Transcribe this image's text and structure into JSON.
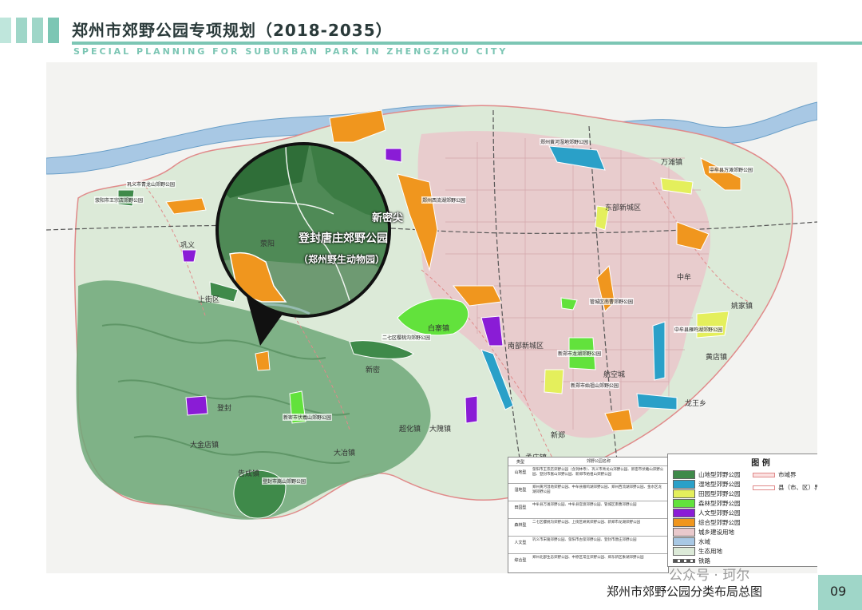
{
  "header": {
    "title": "郑州市郊野公园专项规划（2018-2035）",
    "subtitle": "SPECIAL PLANNING FOR SUBURBAN PARK IN ZHENGZHOU CITY"
  },
  "footer": {
    "map_title": "郑州市郊野公园分类布局总图",
    "page": "09",
    "watermark": "公众号 · 珂尔"
  },
  "inset": {
    "place": "新密尖",
    "park": "登封唐庄郊野公园",
    "park_alt": "（郑州野生动物园）"
  },
  "places": [
    "巩义",
    "荥阳",
    "上街区",
    "登封",
    "新密",
    "新郑",
    "航空城",
    "东部新城区",
    "南部新城区",
    "中牟",
    "万滩镇",
    "姚家镇",
    "黄店镇",
    "大冶镇",
    "大金店镇",
    "超化镇",
    "大隗镇",
    "孟庄镇",
    "龙王乡",
    "白寨镇",
    "告成镇"
  ],
  "park_labels": [
    "荥阳市王宗店郊野公园",
    "巩义市青龙山郊野公园",
    "郑州黄河湿地郊野公园",
    "中牟县雁鸣湖郊野公园",
    "新郑市始祖山郊野公园",
    "新密市伏羲山郊野公园",
    "登封市嵩山郊野公园",
    "郑州西流湖郊野公园",
    "中牟县万滩郊野公园",
    "管城区南曹郊野公园",
    "二七区樱桃沟郊野公园",
    "新郑市龙湖郊野公园"
  ],
  "legend": {
    "title": "图  例",
    "items": [
      {
        "label": "山地型郊野公园",
        "color": "#3f8a4a"
      },
      {
        "label": "湿地型郊野公园",
        "color": "#2aa0c8"
      },
      {
        "label": "田园型郊野公园",
        "color": "#e4ef5c"
      },
      {
        "label": "森林型郊野公园",
        "color": "#62e23c"
      },
      {
        "label": "人文型郊野公园",
        "color": "#8a1cd6"
      },
      {
        "label": "综合型郊野公园",
        "color": "#f0961e"
      },
      {
        "label": "城乡建设用地",
        "color": "#e9c9cc"
      },
      {
        "label": "水域",
        "color": "#a8c8e4"
      },
      {
        "label": "生态用地",
        "color": "#dcead8"
      },
      {
        "label": "铁路",
        "color": "#555555"
      }
    ],
    "boundaries": [
      {
        "label": "市域界",
        "color": "#e08a8a"
      },
      {
        "label": "县（市、区）界",
        "color": "#e08a8a"
      }
    ]
  },
  "classification_table": {
    "header": [
      "类型",
      "郊野公园名称"
    ],
    "rows": [
      {
        "type": "山地型",
        "names": "荥阳市王宗店郊野公园（含洞林寺）、巩义市青龙山郊野公园、新密市伏羲山郊野公园、登封市嵩山郊野公园、新郑市始祖山郊野公园"
      },
      {
        "type": "湿地型",
        "names": "郑州黄河湿地郊野公园、中牟县雁鸣湖郊野公园、郑州西流湖郊野公园、金水区龙湖郊野公园"
      },
      {
        "type": "田园型",
        "names": "中牟县万滩郊野公园、中牟县官渡郊野公园、管城区南曹郊野公园"
      },
      {
        "type": "森林型",
        "names": "二七区樱桃沟郊野公园、上街区峡窝郊野公园、新郑市龙湖郊野公园"
      },
      {
        "type": "人文型",
        "names": "巩义市宋陵郊野公园、荥阳市古荥郊野公园、登封市唐庄郊野公园"
      },
      {
        "type": "综合型",
        "names": "郑州北部生态郊野公园、中原区常庄郊野公园、郑东新区象湖郊野公园"
      }
    ]
  },
  "colors": {
    "mountain": "#3f8a4a",
    "hill": "#7fb88a",
    "urban": "#e9c9cc",
    "water": "#a8c8e4",
    "accent": "#7cc6b4"
  }
}
